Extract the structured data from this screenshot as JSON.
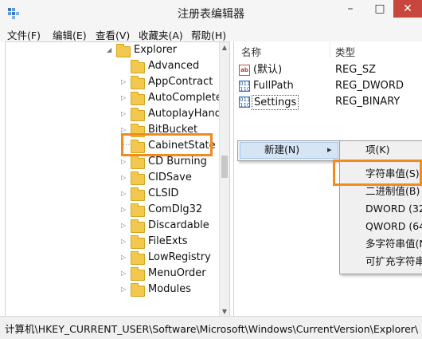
{
  "window": {
    "title": "注册表编辑器",
    "minimize": "–",
    "maximize": "□",
    "close": "✕"
  },
  "menubar": [
    "文件(F)",
    "编辑(E)",
    "查看(V)",
    "收藏夹(A)",
    "帮助(H)"
  ],
  "tree": {
    "parent": "Explorer",
    "items": [
      "Advanced",
      "AppContract",
      "AutoComplete",
      "AutoplayHandl",
      "BitBucket",
      "CabinetState",
      "CD Burning",
      "CIDSave",
      "CLSID",
      "ComDlg32",
      "Discardable",
      "FileExts",
      "LowRegistry",
      "MenuOrder",
      "Modules"
    ],
    "selected": "CabinetState"
  },
  "list": {
    "columns": [
      "名称",
      "类型"
    ],
    "rows": [
      {
        "icon": "string-value-icon",
        "name": "(默认)",
        "type": "REG_SZ"
      },
      {
        "icon": "binary-value-icon",
        "name": "FullPath",
        "type": "REG_DWORD"
      },
      {
        "icon": "binary-value-icon",
        "name": "Settings",
        "type": "REG_BINARY"
      }
    ]
  },
  "context_menu": {
    "new_label": "新建(N)",
    "submenu_arrow": "▸"
  },
  "submenu": {
    "items": [
      "项(K)",
      "字符串值(S)",
      "二进制值(B)",
      "DWORD (32",
      "QWORD (64",
      "多字符串值(N",
      "可扩充字符串"
    ],
    "highlighted": "字符串值(S)"
  },
  "statusbar": {
    "path": "计算机\\HKEY_CURRENT_USER\\Software\\Microsoft\\Windows\\CurrentVersion\\Explorer\\"
  },
  "colors": {
    "highlight_box": "#f28a1e",
    "close_button": "#c7463d",
    "menu_hover": "#d5e5f6"
  }
}
